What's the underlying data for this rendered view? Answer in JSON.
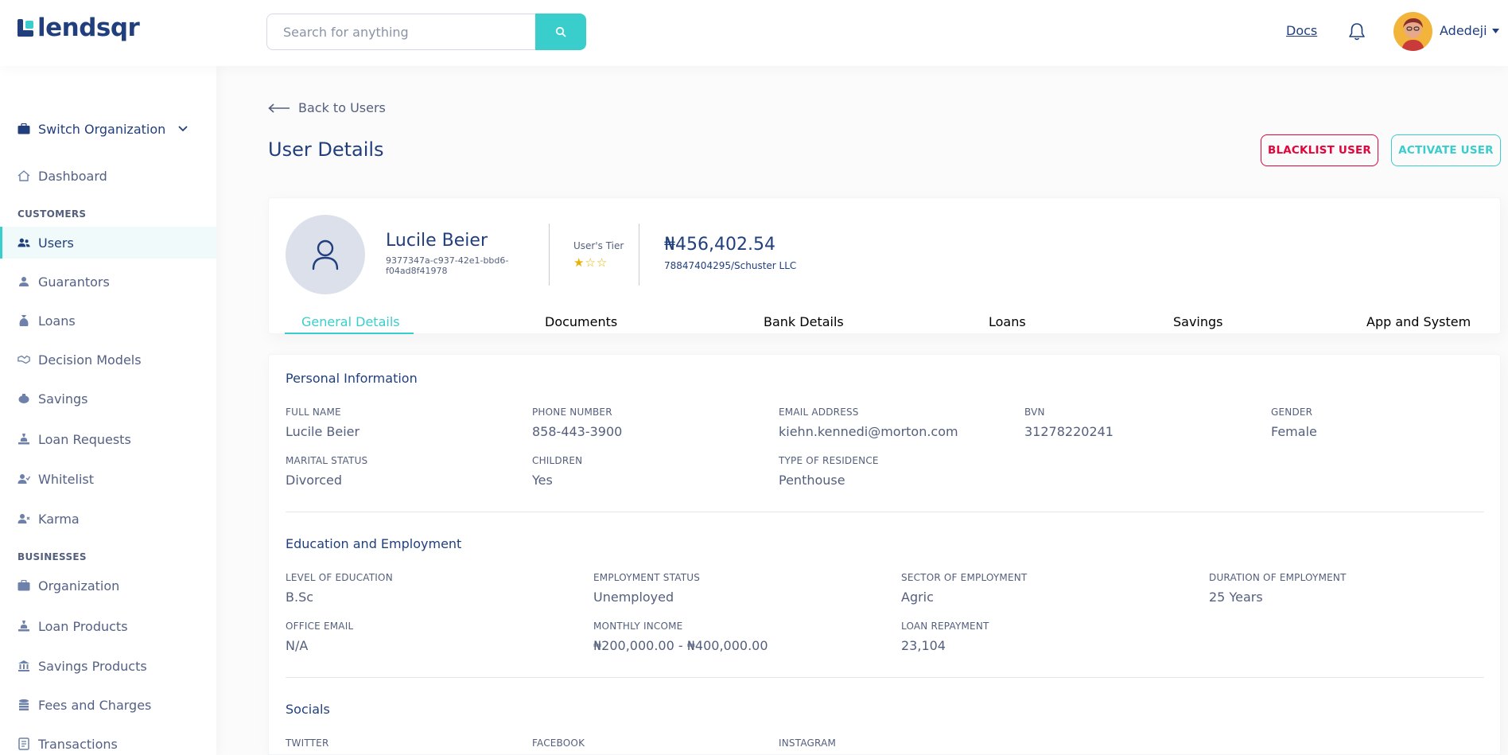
{
  "app": {
    "logo_text": "lendsqr"
  },
  "header": {
    "search_placeholder": "Search for anything",
    "docs_label": "Docs",
    "user_name": "Adedeji"
  },
  "sidebar": {
    "switch_org": "Switch Organization",
    "dashboard": "Dashboard",
    "sections": {
      "customers": "CUSTOMERS",
      "businesses": "BUSINESSES"
    },
    "customers": [
      {
        "label": "Users",
        "icon": "users-icon",
        "active": true
      },
      {
        "label": "Guarantors",
        "icon": "guarantors-icon"
      },
      {
        "label": "Loans",
        "icon": "loans-icon"
      },
      {
        "label": "Decision Models",
        "icon": "handshake-icon"
      },
      {
        "label": "Savings",
        "icon": "piggy-bank-icon"
      },
      {
        "label": "Loan Requests",
        "icon": "loan-request-icon"
      },
      {
        "label": "Whitelist",
        "icon": "user-check-icon"
      },
      {
        "label": "Karma",
        "icon": "user-x-icon"
      }
    ],
    "businesses": [
      {
        "label": "Organization",
        "icon": "briefcase-icon"
      },
      {
        "label": "Loan Products",
        "icon": "loan-products-icon"
      },
      {
        "label": "Savings Products",
        "icon": "bank-icon"
      },
      {
        "label": "Fees and Charges",
        "icon": "coins-icon"
      },
      {
        "label": "Transactions",
        "icon": "transactions-icon"
      }
    ]
  },
  "page": {
    "back_label": "Back to Users",
    "title": "User Details",
    "blacklist_label": "BLACKLIST USER",
    "activate_label": "ACTIVATE USER"
  },
  "profile": {
    "name": "Lucile Beier",
    "id": "9377347a-c937-42e1-bbd6-f04ad8f41978",
    "tier_label": "User's Tier",
    "tier_stars": 1,
    "tier_max": 3,
    "balance": "₦456,402.54",
    "bank": "78847404295/Schuster LLC",
    "tabs": [
      "General Details",
      "Documents",
      "Bank Details",
      "Loans",
      "Savings",
      "App and System"
    ],
    "active_tab": 0
  },
  "personal": {
    "title": "Personal Information",
    "full_name_label": "FULL NAME",
    "full_name": "Lucile Beier",
    "phone_label": "PHONE NUMBER",
    "phone": "858-443-3900",
    "email_label": "EMAIL ADDRESS",
    "email": "kiehn.kennedi@morton.com",
    "bvn_label": "BVN",
    "bvn": "31278220241",
    "gender_label": "GENDER",
    "gender": "Female",
    "marital_label": "MARITAL STATUS",
    "marital": "Divorced",
    "children_label": "CHILDREN",
    "children": "Yes",
    "residence_label": "TYPE OF RESIDENCE",
    "residence": "Penthouse"
  },
  "education": {
    "title": "Education and Employment",
    "level_label": "LEVEL OF EDUCATION",
    "level": "B.Sc",
    "status_label": "EMPLOYMENT STATUS",
    "status": "Unemployed",
    "sector_label": "SECTOR OF EMPLOYMENT",
    "sector": "Agric",
    "duration_label": "DURATION OF EMPLOYMENT",
    "duration": "25 Years",
    "office_email_label": "OFFICE EMAIL",
    "office_email": "N/A",
    "income_label": "MONTHLY INCOME",
    "income": "₦200,000.00 - ₦400,000.00",
    "repayment_label": "LOAN REPAYMENT",
    "repayment": "23,104"
  },
  "socials": {
    "title": "Socials",
    "twitter_label": "TWITTER",
    "facebook_label": "FACEBOOK",
    "instagram_label": "INSTAGRAM"
  },
  "colors": {
    "brand": "#213F7D",
    "accent": "#39CDCC",
    "danger": "#E4033B",
    "star": "#E9B200"
  }
}
